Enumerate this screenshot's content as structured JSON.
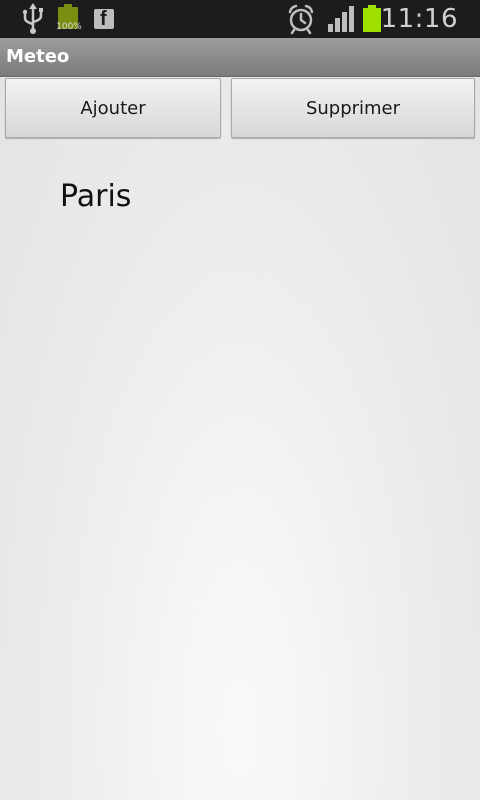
{
  "status_bar": {
    "battery_notification_percent": "100%",
    "time": "11:16",
    "icons": [
      "usb-icon",
      "battery-full-notification-icon",
      "facebook-icon",
      "alarm-icon",
      "signal-icon",
      "battery-icon"
    ]
  },
  "app": {
    "title": "Meteo"
  },
  "toolbar": {
    "add_label": "Ajouter",
    "delete_label": "Supprimer"
  },
  "cities": [
    {
      "name": "Paris"
    }
  ],
  "colors": {
    "accent_battery": "#9fdf00",
    "status_bar_bg": "#1c1c1c",
    "title_bar_bg": "#8c8c8c"
  }
}
